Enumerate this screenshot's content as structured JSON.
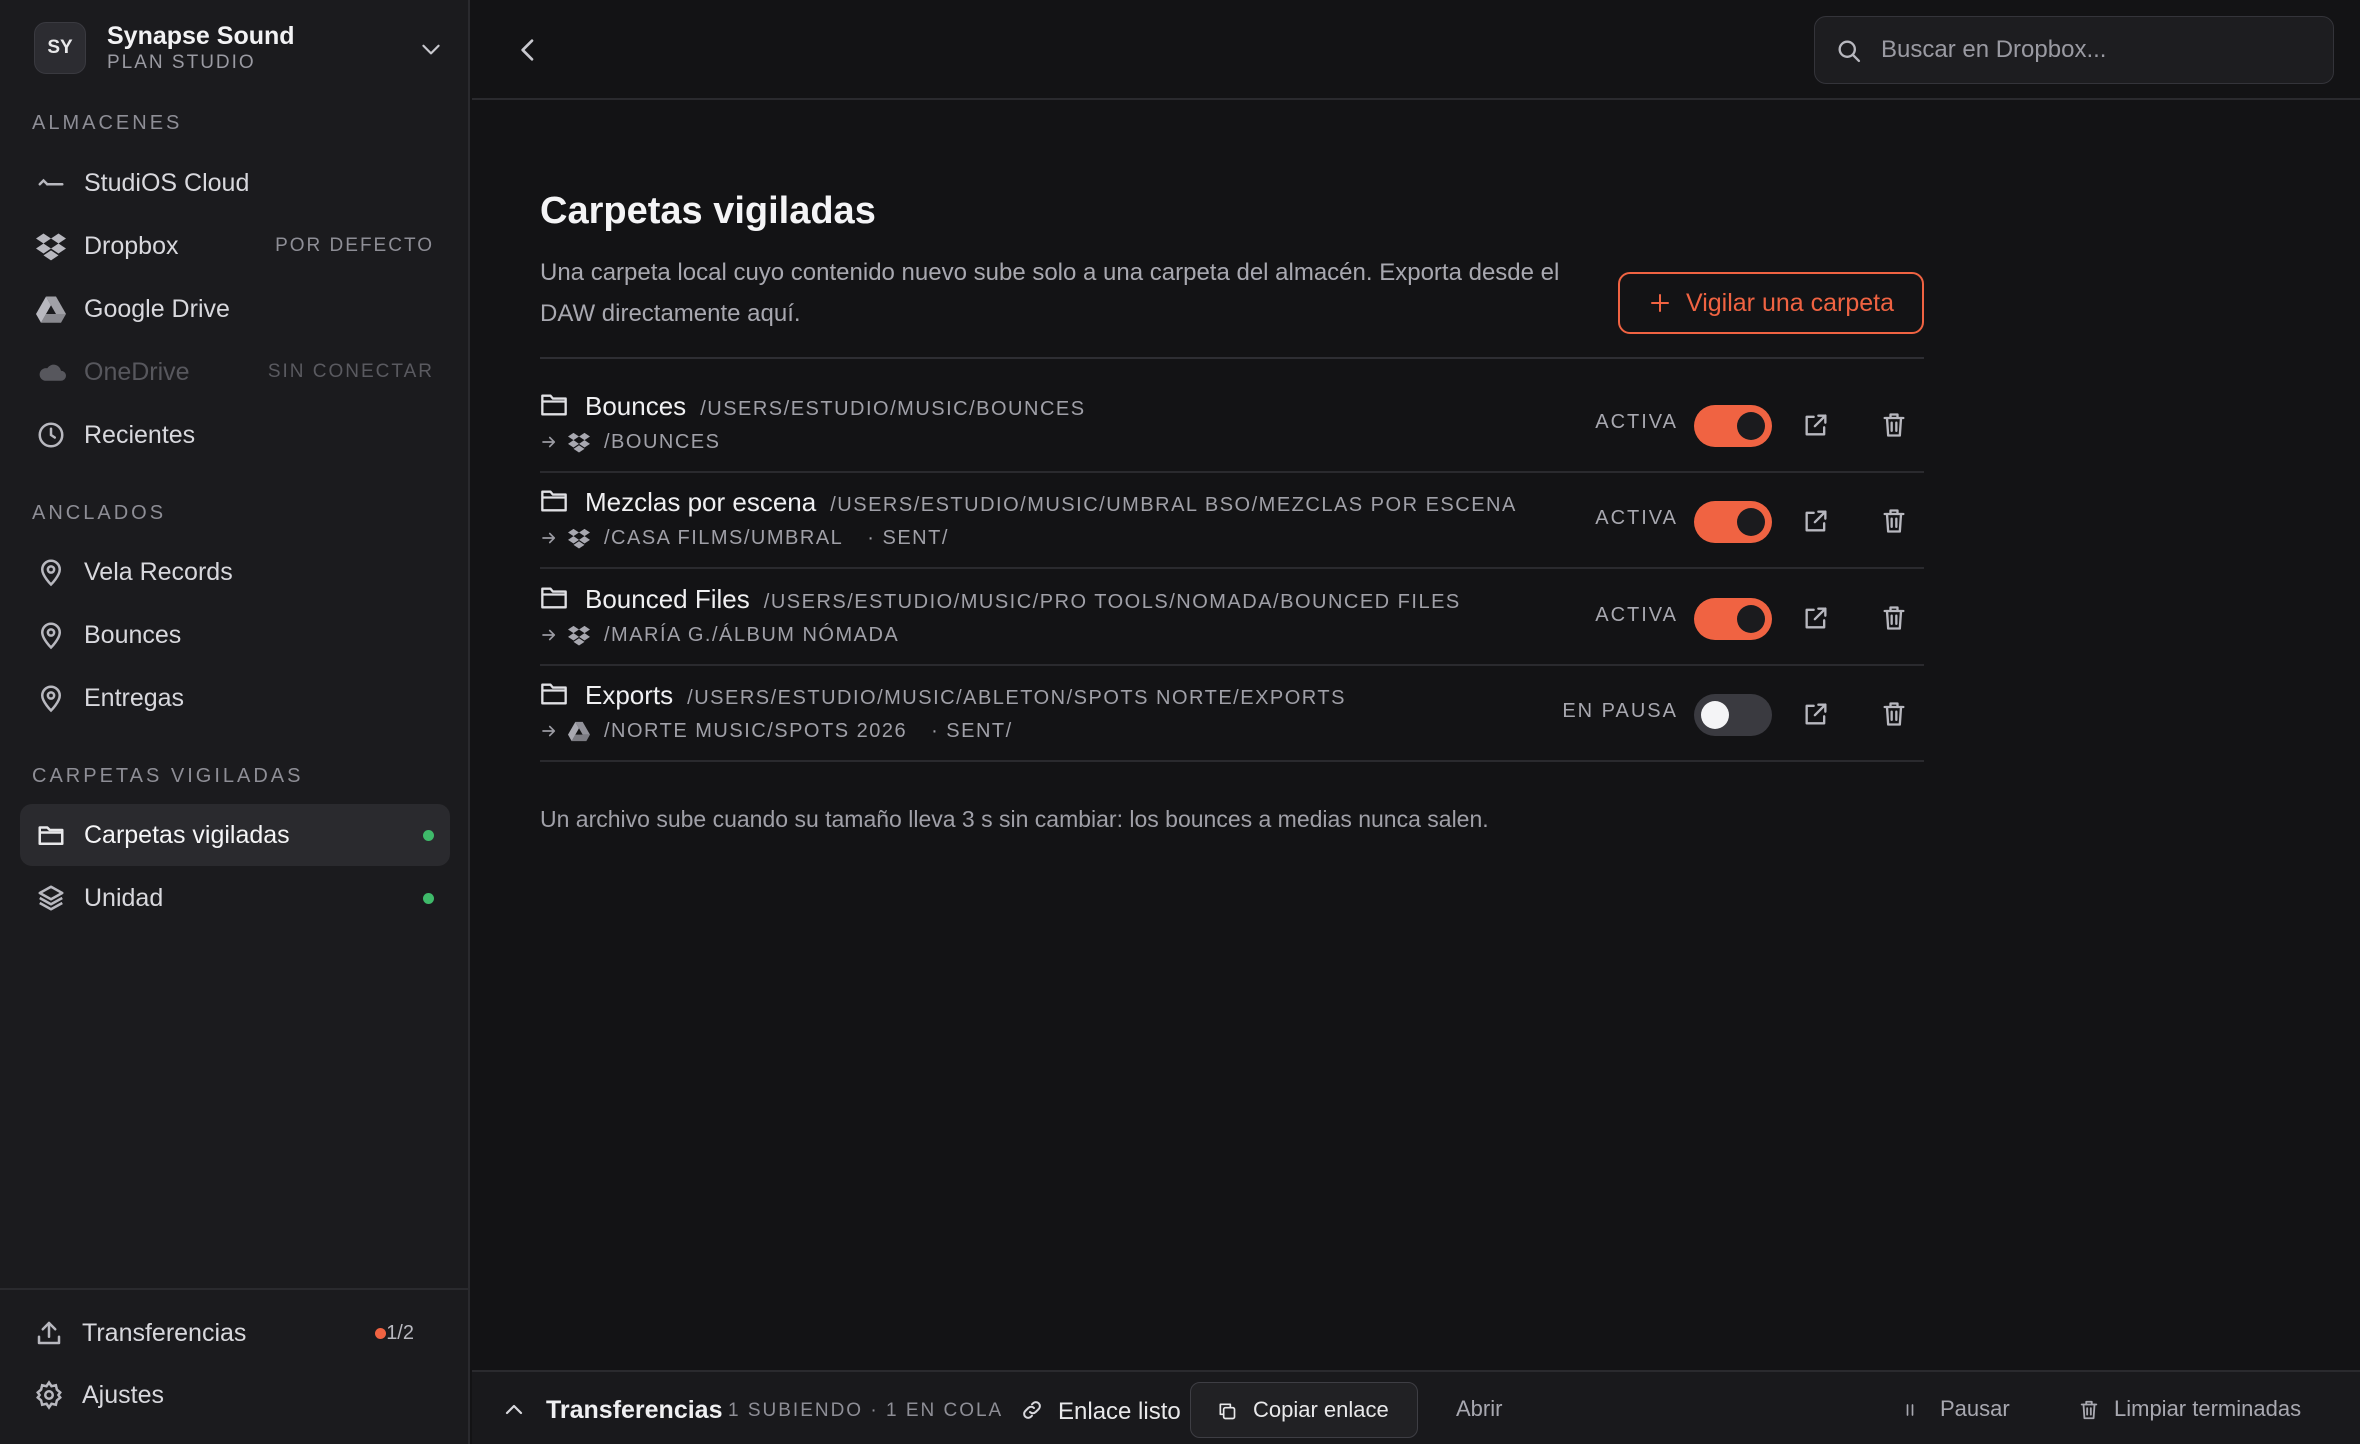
{
  "workspace": {
    "initials": "SY",
    "name": "Synapse Sound",
    "plan": "PLAN STUDIO"
  },
  "sidebar": {
    "storage_label": "ALMACENES",
    "storage": [
      {
        "label": "StudiOS Cloud",
        "icon": "studios-cloud-icon",
        "badge": ""
      },
      {
        "label": "Dropbox",
        "icon": "dropbox-icon",
        "badge": "POR DEFECTO"
      },
      {
        "label": "Google Drive",
        "icon": "google-drive-icon",
        "badge": ""
      },
      {
        "label": "OneDrive",
        "icon": "onedrive-icon",
        "badge": "SIN CONECTAR"
      },
      {
        "label": "Recientes",
        "icon": "clock-icon",
        "badge": ""
      }
    ],
    "pinned_label": "ANCLADOS",
    "pinned": [
      {
        "label": "Vela Records",
        "icon": "pin-icon"
      },
      {
        "label": "Bounces",
        "icon": "pin-icon"
      },
      {
        "label": "Entregas",
        "icon": "pin-icon"
      }
    ],
    "watched_label": "CARPETAS VIGILADAS",
    "watched": [
      {
        "label": "Carpetas vigiladas",
        "icon": "folder-icon",
        "active": true
      },
      {
        "label": "Unidad",
        "icon": "layers-icon",
        "active": false
      }
    ],
    "footer": {
      "transfers_label": "Transferencias",
      "transfers_count": "1/2",
      "settings_label": "Ajustes"
    }
  },
  "search": {
    "placeholder": "Buscar en Dropbox..."
  },
  "main": {
    "title": "Carpetas vigiladas",
    "description": "Una carpeta local cuyo contenido nuevo sube solo a una carpeta del almacén. Exporta desde el DAW directamente aquí.",
    "add_button": "Vigilar una carpeta",
    "folders": [
      {
        "name": "Bounces",
        "path": "/USERS/ESTUDIO/MUSIC/BOUNCES",
        "dest_icon": "dropbox-icon",
        "dest": "/BOUNCES",
        "dest_sub": "",
        "status": "ACTIVA",
        "enabled": true
      },
      {
        "name": "Mezclas por escena",
        "path": "/USERS/ESTUDIO/MUSIC/UMBRAL BSO/MEZCLAS POR ESCENA",
        "dest_icon": "dropbox-icon",
        "dest": "/CASA FILMS/UMBRAL",
        "dest_sub": "· SENT/",
        "status": "ACTIVA",
        "enabled": true
      },
      {
        "name": "Bounced Files",
        "path": "/USERS/ESTUDIO/MUSIC/PRO TOOLS/NOMADA/BOUNCED FILES",
        "dest_icon": "dropbox-icon",
        "dest": "/MARÍA G./ÁLBUM NÓMADA",
        "dest_sub": "",
        "status": "ACTIVA",
        "enabled": true
      },
      {
        "name": "Exports",
        "path": "/USERS/ESTUDIO/MUSIC/ABLETON/SPOTS NORTE/EXPORTS",
        "dest_icon": "google-drive-icon",
        "dest": "/NORTE MUSIC/SPOTS 2026",
        "dest_sub": "· SENT/",
        "status": "EN PAUSA",
        "enabled": false
      }
    ],
    "footnote": "Un archivo sube cuando su tamaño lleva 3 s sin cambiar: los bounces a medias nunca salen."
  },
  "bottombar": {
    "title": "Transferencias",
    "meta": "1 SUBIENDO · 1 EN COLA",
    "link_label": "Enlace listo",
    "copy_label": "Copiar enlace",
    "open_label": "Abrir",
    "pause_label": "Pausar",
    "clear_label": "Limpiar terminadas"
  },
  "colors": {
    "accent": "#f06342",
    "status_dot": "#3fba6a",
    "background": "#131315",
    "sidebar": "#1b1b1e"
  }
}
